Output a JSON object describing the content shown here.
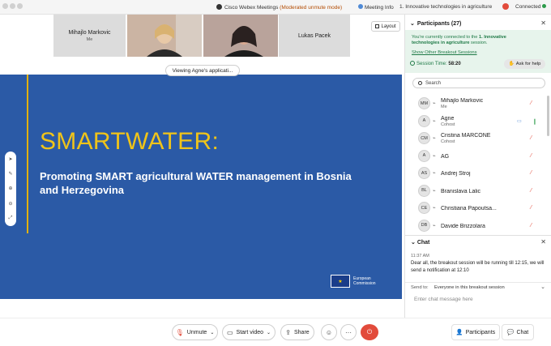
{
  "window": {
    "app_title": "Cisco Webex Meetings",
    "mode": "(Moderated unmute mode)",
    "meeting_info": "Meeting Info",
    "room": "1.  Innovative technologies in agriculture",
    "connection": "Connected"
  },
  "videos": {
    "tile1_name": "Mihajlo Markovic",
    "tile1_me": "Me",
    "tile2_name": "Lukas Pacek",
    "layout_label": "Layout"
  },
  "viewing_label": "Viewing Agne's applicati...",
  "slide": {
    "title": "SMARTWATER:",
    "subtitle": "Promoting SMART agricultural WATER management in Bosnia and Herzegovina",
    "logo_line1": "European",
    "logo_line2": "Commission"
  },
  "participants_panel": {
    "title": "Participants (27)",
    "notice_pre": "You're currently connected to the ",
    "notice_room": "1.  Innovative technologies in agriculture",
    "notice_post": " session.",
    "show_other": "Show Other Breakout Sessions",
    "session_time_label": "Session Time: ",
    "session_time": "58:20",
    "ask_help": "Ask for help",
    "search_placeholder": "Search",
    "participants": [
      {
        "initials": "MM",
        "name": "Mihajlo Markovic",
        "role": "Me",
        "status": "muted"
      },
      {
        "initials": "A",
        "name": "Agne",
        "role": "Cohost",
        "status": "unmuted"
      },
      {
        "initials": "CM",
        "name": "Cristina MARCONE",
        "role": "Cohost",
        "status": "muted"
      },
      {
        "initials": "A",
        "name": "AG",
        "role": "",
        "status": "muted"
      },
      {
        "initials": "AS",
        "name": "Andrej Stroj",
        "role": "",
        "status": "muted"
      },
      {
        "initials": "BL",
        "name": "Branislava Lalic",
        "role": "",
        "status": "muted"
      },
      {
        "initials": "CE",
        "name": "Christiana Papoutsa...",
        "role": "",
        "status": "muted"
      },
      {
        "initials": "DB",
        "name": "Davide Brizzolara",
        "role": "",
        "status": "muted"
      }
    ]
  },
  "chat_panel": {
    "title": "Chat",
    "time": "11:37 AM",
    "message": "Dear all, the breakout session will be running till 12:15, we will send a notification at 12:10",
    "send_to_label": "Send to:",
    "send_to_value": "Everyone in this breakout session",
    "input_placeholder": "Enter chat message here"
  },
  "controls": {
    "unmute": "Unmute",
    "start_video": "Start video",
    "share": "Share",
    "participants": "Participants",
    "chat": "Chat"
  },
  "colors": {
    "slide_bg": "#2b5aa6",
    "slide_title": "#f0c419",
    "notice_bg": "#e7f4ec",
    "end_button": "#e24b3b",
    "mic_muted": "#e24b3b"
  }
}
